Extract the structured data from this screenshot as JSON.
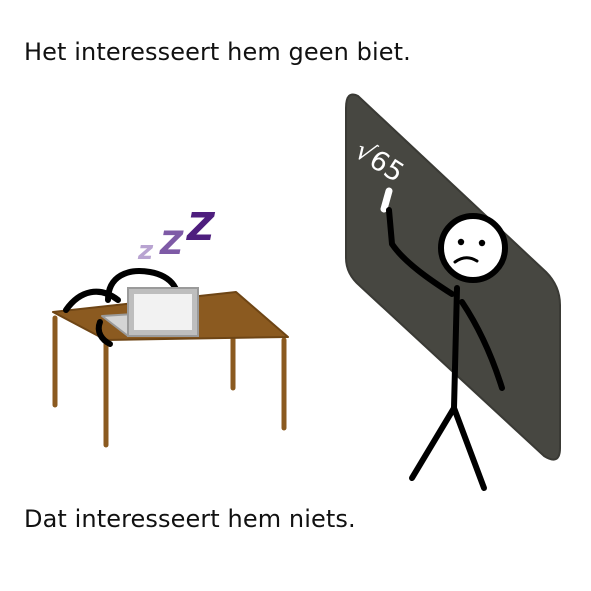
{
  "captions": {
    "top": "Het interesseert hem geen biet.",
    "bottom": "Dat interesseert hem niets."
  },
  "illustration": {
    "sleep_letters": [
      "z",
      "Z",
      "Z"
    ],
    "chalkboard_writing": "√65",
    "colors": {
      "desk": "#8B5A20",
      "chalkboard": "#474741",
      "sleep_light": "#B8A3D1",
      "sleep_medium": "#7E5AA6",
      "sleep_dark": "#4E1E7E",
      "laptop": "#BEBEBE",
      "chalk": "#FFFFFF"
    }
  }
}
